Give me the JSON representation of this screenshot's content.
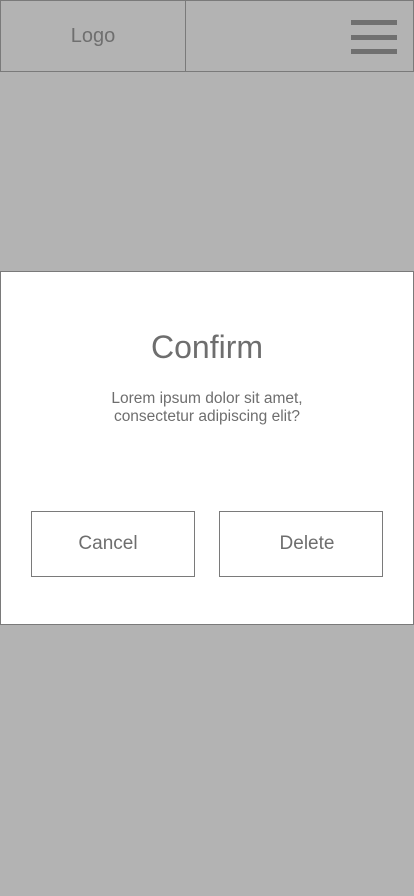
{
  "header": {
    "logo_text": "Logo",
    "menu_icon": "hamburger-menu-icon"
  },
  "dialog": {
    "title": "Confirm",
    "message_line1": "Lorem ipsum dolor sit amet,",
    "message_line2": "consectetur adipiscing elit?",
    "cancel_label": "Cancel",
    "delete_label": "Delete"
  },
  "colors": {
    "backdrop": "#b3b3b3",
    "dialog_bg": "#ffffff",
    "border": "#7a7a7a",
    "text": "#6e6e6e"
  }
}
